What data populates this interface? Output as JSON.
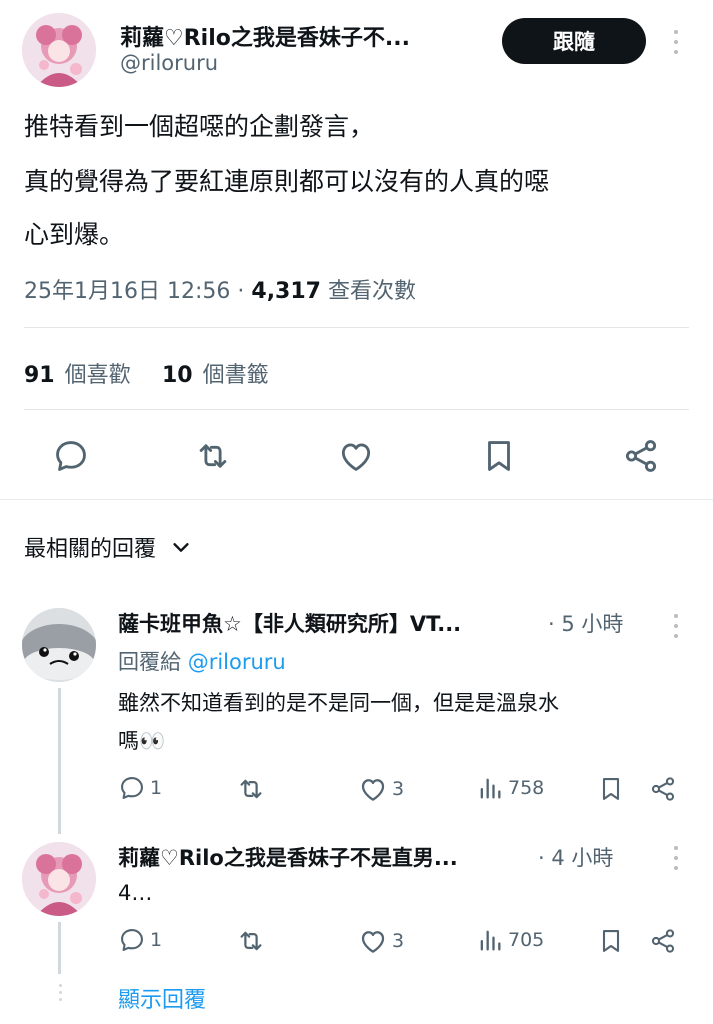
{
  "tweet": {
    "author_name": "莉蘿♡Rilo之我是香妹子不...",
    "author_handle": "@riloruru",
    "follow_label": "跟隨",
    "text_line1": "推特看到一個超噁的企劃發言，",
    "text_line2": "真的覺得為了要紅連原則都可以沒有的人真的噁",
    "text_line3": "心到爆。",
    "timestamp": "25年1月16日 12:56",
    "separator": "·",
    "views_count": "4,317",
    "views_label": "查看次數",
    "likes_count": "91",
    "likes_label": "個喜歡",
    "bookmarks_count": "10",
    "bookmarks_label": "個書籤"
  },
  "replies_header": {
    "label": "最相關的回覆"
  },
  "replies": [
    {
      "name": "薩卡班甲魚☆【非人類研究所】VT...",
      "time": "· 5 小時",
      "reply_to_prefix": "回覆給",
      "reply_to_handle": "@riloruru",
      "text_line1": "雖然不知道看到的是不是同一個，但是是溫泉水",
      "text_line2": "嗎👀",
      "reply_count": "1",
      "like_count": "3",
      "view_count": "758"
    },
    {
      "name": "莉蘿♡Rilo之我是香妹子不是直男...",
      "time": "· 4 小時",
      "text_line1": "4…",
      "reply_count": "1",
      "like_count": "3",
      "view_count": "705"
    }
  ],
  "show_replies_label": "顯示回覆",
  "colors": {
    "text": "#0f1419",
    "muted": "#536471",
    "link": "#1d9bf0",
    "divider": "#e3e6e8"
  },
  "icons": [
    "more-vert-icon",
    "reply-icon",
    "retweet-icon",
    "like-icon",
    "bookmark-icon",
    "share-icon",
    "views-icon",
    "chevron-down-icon"
  ]
}
